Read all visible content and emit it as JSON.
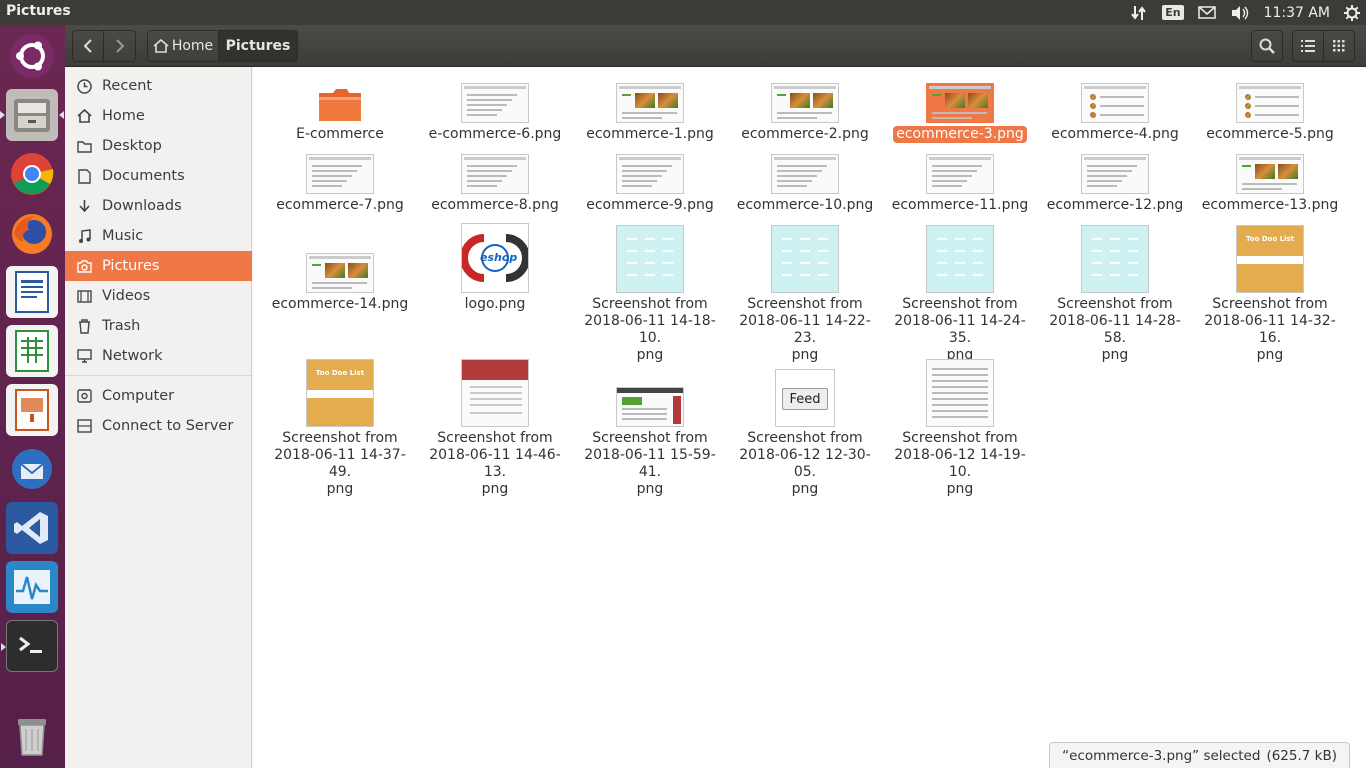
{
  "window": {
    "title": "Pictures"
  },
  "indicators": {
    "keyboard": "En",
    "clock": "11:37 AM"
  },
  "breadcrumb": {
    "home": "Home",
    "current": "Pictures"
  },
  "sidebar": {
    "items": [
      {
        "label": "Recent",
        "icon": "clock-icon"
      },
      {
        "label": "Home",
        "icon": "home-icon"
      },
      {
        "label": "Desktop",
        "icon": "folder-icon"
      },
      {
        "label": "Documents",
        "icon": "document-icon"
      },
      {
        "label": "Downloads",
        "icon": "download-icon"
      },
      {
        "label": "Music",
        "icon": "music-icon"
      },
      {
        "label": "Pictures",
        "icon": "camera-icon",
        "active": true
      },
      {
        "label": "Videos",
        "icon": "video-icon"
      },
      {
        "label": "Trash",
        "icon": "trash-icon"
      },
      {
        "label": "Network",
        "icon": "network-icon"
      },
      {
        "label": "Computer",
        "icon": "computer-icon"
      },
      {
        "label": "Connect to Server",
        "icon": "server-icon"
      }
    ]
  },
  "files": [
    {
      "name": "E-commerce",
      "kind": "folder"
    },
    {
      "name": "e-commerce-6.png",
      "kind": "doc"
    },
    {
      "name": "ecommerce-1.png",
      "kind": "food"
    },
    {
      "name": "ecommerce-2.png",
      "kind": "food"
    },
    {
      "name": "ecommerce-3.png",
      "kind": "food",
      "selected": true
    },
    {
      "name": "ecommerce-4.png",
      "kind": "list"
    },
    {
      "name": "ecommerce-5.png",
      "kind": "list"
    },
    {
      "name": "ecommerce-7.png",
      "kind": "doc"
    },
    {
      "name": "ecommerce-8.png",
      "kind": "doc"
    },
    {
      "name": "ecommerce-9.png",
      "kind": "doc"
    },
    {
      "name": "ecommerce-10.png",
      "kind": "doc"
    },
    {
      "name": "ecommerce-11.png",
      "kind": "doc"
    },
    {
      "name": "ecommerce-12.png",
      "kind": "doc"
    },
    {
      "name": "ecommerce-13.png",
      "kind": "food"
    },
    {
      "name": "ecommerce-14.png",
      "kind": "food"
    },
    {
      "name": "logo.png",
      "kind": "logo",
      "logo_text": "eshop"
    },
    {
      "name": "Screenshot from 2018-06-11 14-18-10.png",
      "kind": "cyan"
    },
    {
      "name": "Screenshot from 2018-06-11 14-22-23.png",
      "kind": "cyan"
    },
    {
      "name": "Screenshot from 2018-06-11 14-24-35.png",
      "kind": "cyan"
    },
    {
      "name": "Screenshot from 2018-06-11 14-28-58.png",
      "kind": "cyan"
    },
    {
      "name": "Screenshot from 2018-06-11 14-32-16.png",
      "kind": "todo",
      "thumb_text": "Too Doo List"
    },
    {
      "name": "Screenshot from 2018-06-11 14-37-49.png",
      "kind": "todo",
      "thumb_text": "Too Doo List"
    },
    {
      "name": "Screenshot from 2018-06-11 14-46-13.png",
      "kind": "redhead"
    },
    {
      "name": "Screenshot from 2018-06-11 15-59-41.png",
      "kind": "web"
    },
    {
      "name": "Screenshot from 2018-06-12 12-30-05.png",
      "kind": "feed",
      "thumb_text": "Feed"
    },
    {
      "name": "Screenshot from 2018-06-12 14-19-10.png",
      "kind": "doc"
    }
  ],
  "status": {
    "text": "“ecommerce-3.png” selected",
    "size": "(625.7 kB)"
  },
  "colors": {
    "accent": "#f07746",
    "launcher": "#5e2750",
    "panel": "#3c3b37"
  }
}
